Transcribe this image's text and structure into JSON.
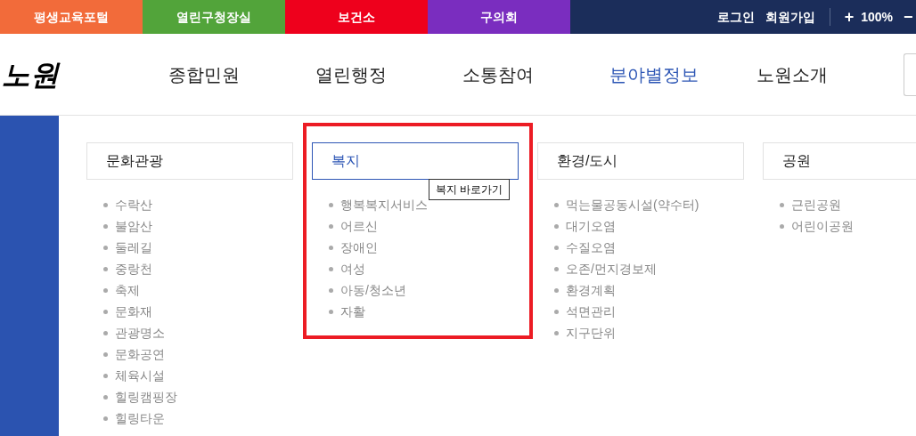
{
  "top_links": [
    {
      "label": "평생교육포털",
      "color": "#f26b3a"
    },
    {
      "label": "열린구청장실",
      "color": "#52a43a"
    },
    {
      "label": "보건소",
      "color": "#ee001c"
    },
    {
      "label": "구의회",
      "color": "#7a2dbf"
    }
  ],
  "account_links": [
    "로그인",
    "회원가입"
  ],
  "zoom": {
    "increase": "+",
    "value": "100%",
    "decrease": "−"
  },
  "logo": "노원",
  "nav": [
    {
      "label": "종합민원",
      "selected": false
    },
    {
      "label": "열린행정",
      "selected": false
    },
    {
      "label": "소통참여",
      "selected": false
    },
    {
      "label": "분야별정보",
      "selected": true
    },
    {
      "label": "노원소개",
      "selected": false
    }
  ],
  "columns": [
    {
      "title": "문화관광",
      "selected": false,
      "highlighted": false,
      "items": [
        "수락산",
        "불암산",
        "둘레길",
        "중랑천",
        "축제",
        "문화재",
        "관광명소",
        "문화공연",
        "체육시설",
        "힐링캠핑장",
        "힐링타운"
      ]
    },
    {
      "title": "복지",
      "selected": true,
      "highlighted": true,
      "tooltip": "복지 바로가기",
      "items": [
        "행복복지서비스",
        "어르신",
        "장애인",
        "여성",
        "아동/청소년",
        "자활"
      ]
    },
    {
      "title": "환경/도시",
      "selected": false,
      "highlighted": false,
      "items": [
        "먹는물공동시설(약수터)",
        "대기오염",
        "수질오염",
        "오존/먼지경보제",
        "환경계획",
        "석면관리",
        "지구단위"
      ]
    },
    {
      "title": "공원",
      "selected": false,
      "highlighted": false,
      "items": [
        "근린공원",
        "어린이공원"
      ]
    }
  ]
}
